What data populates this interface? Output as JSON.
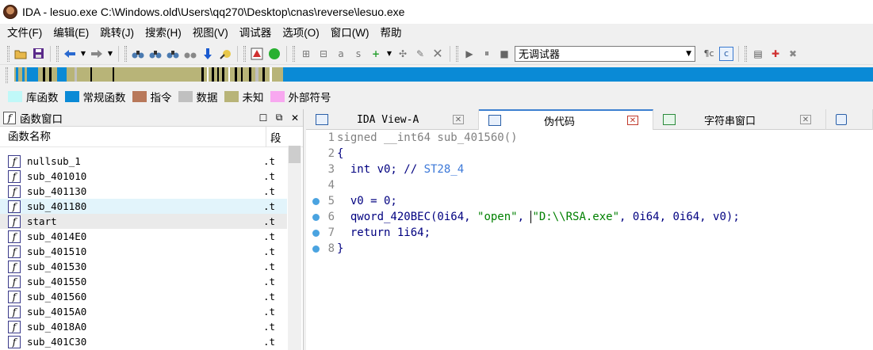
{
  "window": {
    "title": "IDA - lesuo.exe C:\\Windows.old\\Users\\qq270\\Desktop\\cnas\\reverse\\lesuo.exe"
  },
  "menu": [
    "文件(F)",
    "编辑(E)",
    "跳转(J)",
    "搜索(H)",
    "视图(V)",
    "调试器",
    "选项(O)",
    "窗口(W)",
    "帮助"
  ],
  "toolbar": {
    "debugger_select": "无调试器"
  },
  "legend": [
    {
      "label": "库函数",
      "color": "#c0f8f8"
    },
    {
      "label": "常规函数",
      "color": "#0a8ad6"
    },
    {
      "label": "指令",
      "color": "#b8785a"
    },
    {
      "label": "数据",
      "color": "#c0c0c0"
    },
    {
      "label": "未知",
      "color": "#b8b478"
    },
    {
      "label": "外部符号",
      "color": "#f8a8f0"
    }
  ],
  "functions_window": {
    "title": "函数窗口",
    "col_name": "函数名称",
    "col_segment": "段",
    "rows": [
      {
        "name": "nullsub_1",
        "seg": ".t"
      },
      {
        "name": "sub_401010",
        "seg": ".t"
      },
      {
        "name": "sub_401130",
        "seg": ".t"
      },
      {
        "name": "sub_401180",
        "seg": ".t"
      },
      {
        "name": "start",
        "seg": ".t"
      },
      {
        "name": "sub_4014E0",
        "seg": ".t"
      },
      {
        "name": "sub_401510",
        "seg": ".t"
      },
      {
        "name": "sub_401530",
        "seg": ".t"
      },
      {
        "name": "sub_401550",
        "seg": ".t"
      },
      {
        "name": "sub_401560",
        "seg": ".t"
      },
      {
        "name": "sub_4015A0",
        "seg": ".t"
      },
      {
        "name": "sub_4018A0",
        "seg": ".t"
      },
      {
        "name": "sub_401C30",
        "seg": ".t"
      }
    ]
  },
  "tabs": [
    {
      "label": "IDA View-A"
    },
    {
      "label": "伪代码"
    },
    {
      "label": "字符串窗口"
    }
  ],
  "code": {
    "line_numbers": [
      "1",
      "2",
      "3",
      "4",
      "5",
      "6",
      "7",
      "8"
    ],
    "l1": "signed __int64 sub_401560()",
    "l2": "{",
    "l3_kw": "  int v0; // ",
    "l3_cmt": "ST28_4",
    "l5": "  v0 = 0;",
    "l6_fn": "  qword_420BEC(0i64, ",
    "l6_s1": "\"open\"",
    "l6_sep": ", ",
    "l6_s2": "\"D:\\\\RSA.exe\"",
    "l6_rest": ", 0i64, 0i64, v0);",
    "l7": "  return 1i64;",
    "l8": "}"
  }
}
